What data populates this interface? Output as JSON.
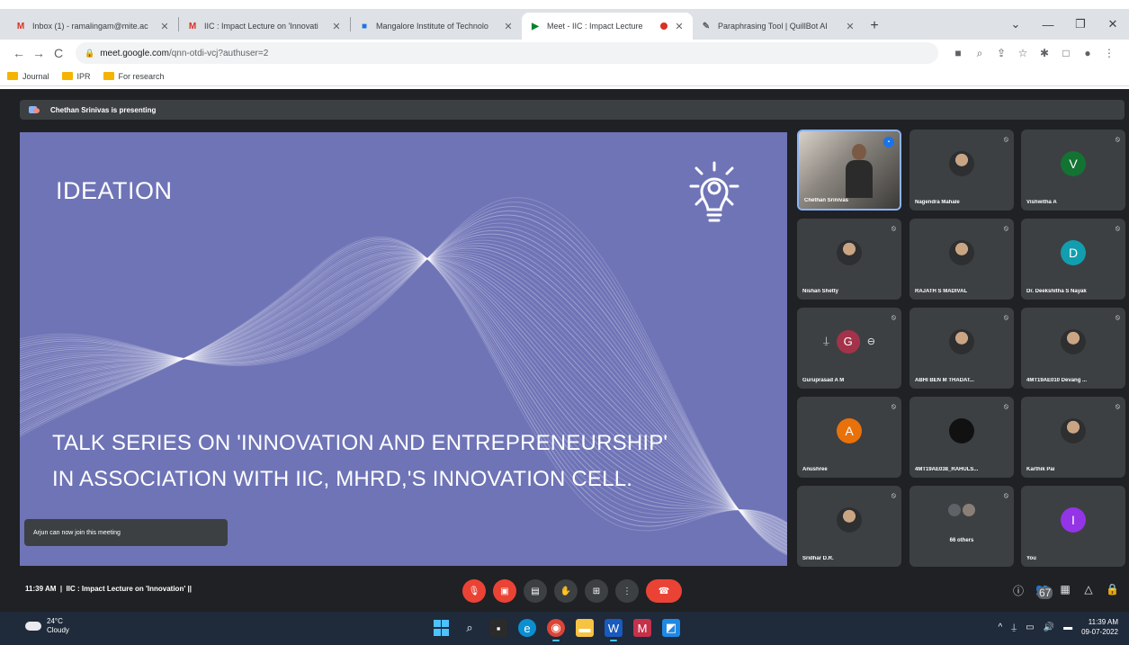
{
  "browser": {
    "tabs": [
      {
        "icon": "gmail-icon",
        "favicon": "M",
        "favcolor": "#d93025",
        "title": "Inbox (1) - ramalingam@mite.ac"
      },
      {
        "icon": "gmail-icon",
        "favicon": "M",
        "favcolor": "#d93025",
        "title": "IIC : Impact Lecture on 'Innovati"
      },
      {
        "icon": "site-icon",
        "favicon": "■",
        "favcolor": "#1a73e8",
        "title": "Mangalore Institute of Technolo"
      },
      {
        "icon": "meet-icon",
        "favicon": "▶",
        "favcolor": "#00832d",
        "title": "Meet - IIC : Impact Lecture"
      },
      {
        "icon": "quillbot-icon",
        "favicon": "✎",
        "favcolor": "#5f6368",
        "title": "Paraphrasing Tool | QuillBot AI"
      }
    ],
    "url_host": "meet.google.com",
    "url_path": "/qnn-otdi-vcj?authuser=2",
    "bookmarks": [
      "Journal",
      "IPR",
      "For research"
    ]
  },
  "meet": {
    "presenting_text": "Chethan Srinivas is presenting",
    "slide": {
      "title": "IDEATION",
      "subtitle_line1": "TALK SERIES ON 'INNOVATION AND ENTREPRENEURSHIP'",
      "subtitle_line2": "IN ASSOCIATION WITH IIC, MHRD,'S INNOVATION CELL."
    },
    "toast": "Arjun can now join this meeting",
    "participants": [
      {
        "name": "Chethan Srinivas",
        "type": "video"
      },
      {
        "name": "Nagendra Mahale",
        "type": "photo"
      },
      {
        "name": "Vishwitha A",
        "type": "letter",
        "letter": "V",
        "color": "#137333"
      },
      {
        "name": "Nishan Shetty",
        "type": "photo"
      },
      {
        "name": "RAJATH S MADIVAL",
        "type": "photo"
      },
      {
        "name": "Dr. Deekshitha S Nayak",
        "type": "letter",
        "letter": "D",
        "color": "#129eaf"
      },
      {
        "name": "Guruprasad A M",
        "type": "g"
      },
      {
        "name": "ABHI BEN M THADAT...",
        "type": "photo"
      },
      {
        "name": "4MT19AE010 Devang ...",
        "type": "photo"
      },
      {
        "name": "Anushree",
        "type": "letter",
        "letter": "A",
        "color": "#e8710a"
      },
      {
        "name": "4MT19AE038_RAHULS...",
        "type": "dark"
      },
      {
        "name": "Karthik Pai",
        "type": "photo"
      },
      {
        "name": "Sridhar D.R.",
        "type": "photo"
      },
      {
        "name": "66 others",
        "type": "others"
      },
      {
        "name": "You",
        "type": "letter",
        "letter": "I",
        "color": "#9334e6"
      }
    ],
    "bottom": {
      "time": "11:39 AM",
      "meeting_title": "IIC : Impact Lecture on 'Innovation' ||",
      "people_count": "67"
    }
  },
  "taskbar": {
    "temperature": "24°C",
    "weather": "Cloudy",
    "time": "11:39 AM",
    "date": "09-07-2022"
  }
}
